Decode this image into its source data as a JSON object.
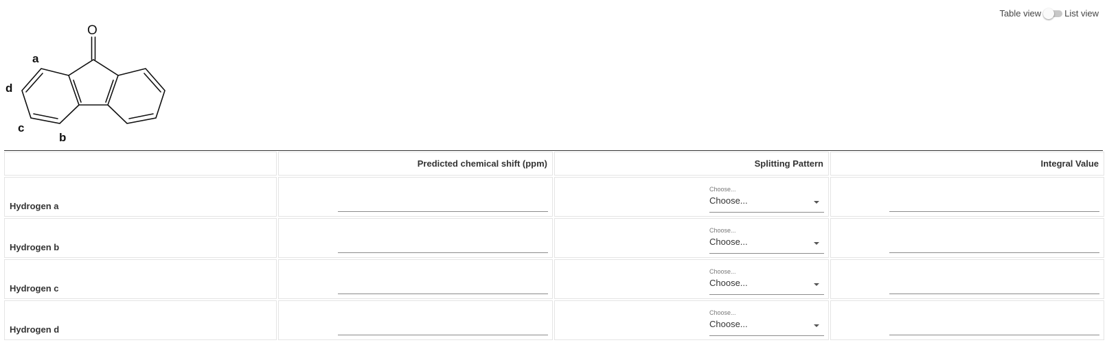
{
  "view_toggle": {
    "left_label": "Table view",
    "right_label": "List view"
  },
  "molecule": {
    "oxygen_label": "O",
    "hydrogen_labels": [
      "a",
      "b",
      "c",
      "d"
    ]
  },
  "table": {
    "headers": [
      "",
      "Predicted chemical shift (ppm)",
      "Splitting Pattern",
      "Integral Value"
    ],
    "rows": [
      {
        "label": "Hydrogen a",
        "shift": "",
        "splitting": {
          "floating_label": "Choose...",
          "selected": "Choose..."
        },
        "integral": ""
      },
      {
        "label": "Hydrogen b",
        "shift": "",
        "splitting": {
          "floating_label": "Choose...",
          "selected": "Choose..."
        },
        "integral": ""
      },
      {
        "label": "Hydrogen c",
        "shift": "",
        "splitting": {
          "floating_label": "Choose...",
          "selected": "Choose..."
        },
        "integral": ""
      },
      {
        "label": "Hydrogen d",
        "shift": "",
        "splitting": {
          "floating_label": "Choose...",
          "selected": "Choose..."
        },
        "integral": ""
      }
    ]
  }
}
